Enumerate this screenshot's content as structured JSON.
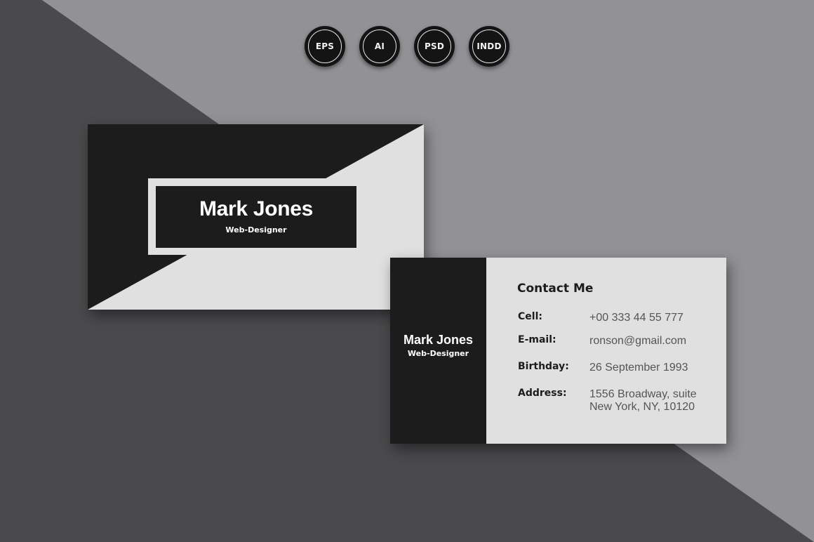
{
  "formats": [
    "EPS",
    "AI",
    "PSD",
    "INDD"
  ],
  "front_card": {
    "name": "Mark Jones",
    "role": "Web-Designer"
  },
  "back_card": {
    "name": "Mark Jones",
    "role": "Web-Designer",
    "heading": "Contact Me",
    "contacts": [
      {
        "label": "Cell:",
        "value": "+00 333 44 55 777"
      },
      {
        "label": "E-mail:",
        "value": "ronson@gmail.com"
      },
      {
        "label": "Birthday:",
        "value": "26 September 1993"
      },
      {
        "label": "Address:",
        "value": "1556 Broadway, suite",
        "value2": "New York, NY, 10120"
      }
    ]
  },
  "colors": {
    "card_dark": "#1c1c1c",
    "card_light": "#e0e0e0",
    "bg_dark": "#4a4a4c",
    "bg_light": "#929296"
  }
}
